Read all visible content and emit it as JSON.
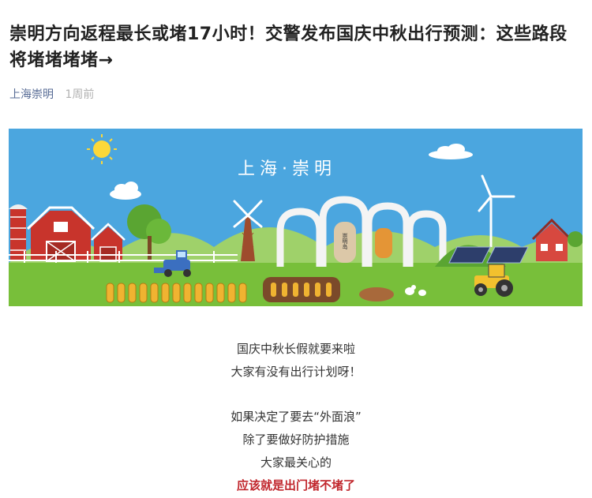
{
  "article": {
    "title": "崇明方向返程最长或堵17小时！交警发布国庆中秋出行预测：这些路段将堵堵堵堵→",
    "author": "上海崇明",
    "time": "1周前"
  },
  "banner": {
    "caption": "上海·崇明",
    "gate_text": "崇明岛",
    "colors": {
      "sky": "#4ba6df",
      "grass": "#78bf3a",
      "barn": "#c8342c"
    }
  },
  "body_lines": {
    "l1": "国庆中秋长假就要来啦",
    "l2": "大家有没有出行计划呀！",
    "l3": "如果决定了要去“外面浪”",
    "l4": "除了要做好防护措施",
    "l5": "大家最关心的",
    "l6": "应该就是出门堵不堵了"
  }
}
